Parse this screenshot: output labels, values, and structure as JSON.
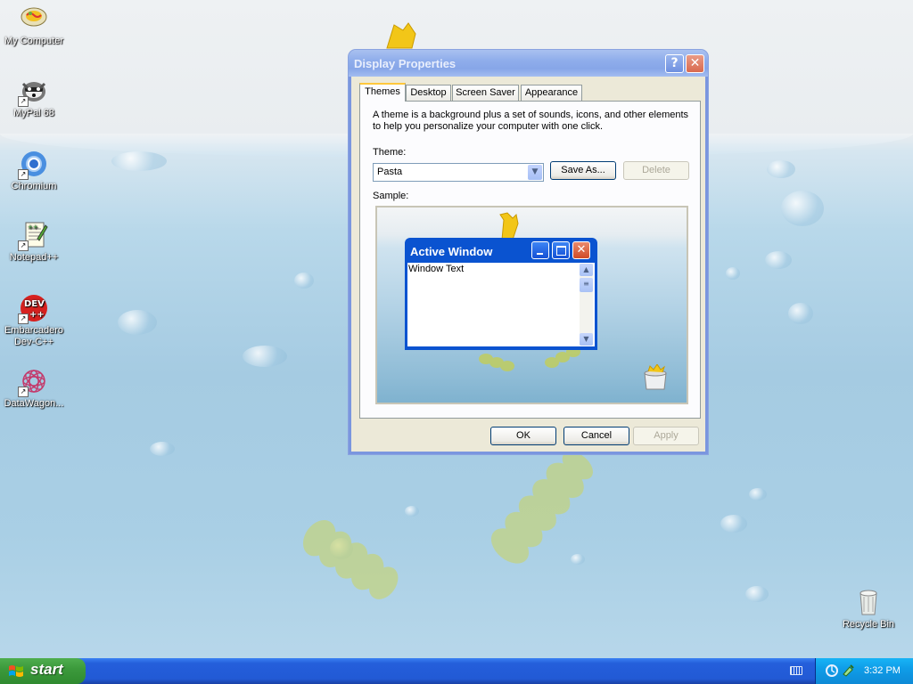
{
  "desktop_icons": [
    {
      "label": "My Computer",
      "icon": "my-computer-icon"
    },
    {
      "label": "MyPal 68",
      "icon": "mypal-icon"
    },
    {
      "label": "Chromium",
      "icon": "chromium-icon"
    },
    {
      "label": "Notepad++",
      "icon": "notepadpp-icon"
    },
    {
      "label": "Embarcadero Dev-C++",
      "icon": "devcpp-icon",
      "icon_text": "DEV\n++"
    },
    {
      "label": "DataWagon...",
      "icon": "datawagon-icon"
    }
  ],
  "recycle_bin": {
    "label": "Recycle Bin"
  },
  "dialog": {
    "title": "Display Properties",
    "help_label": "?",
    "close_label": "✕",
    "tabs": [
      {
        "label": "Themes",
        "active": true
      },
      {
        "label": "Desktop"
      },
      {
        "label": "Screen Saver"
      },
      {
        "label": "Appearance"
      }
    ],
    "description": "A theme is a background plus a set of sounds, icons, and other elements to help you personalize your computer with one click.",
    "theme_label": "Theme:",
    "theme_value": "Pasta",
    "save_as_label": "Save As...",
    "delete_label": "Delete",
    "sample_label": "Sample:",
    "sample_window": {
      "title": "Active Window",
      "text": "Window Text"
    },
    "ok_label": "OK",
    "cancel_label": "Cancel",
    "apply_label": "Apply"
  },
  "taskbar": {
    "start_label": "start",
    "clock": "3:32 PM"
  },
  "colors": {
    "taskbar_blue": "#245edb",
    "start_green": "#3c9a3c",
    "tray_blue": "#0f9de8",
    "dialog_face": "#ece9d8"
  }
}
